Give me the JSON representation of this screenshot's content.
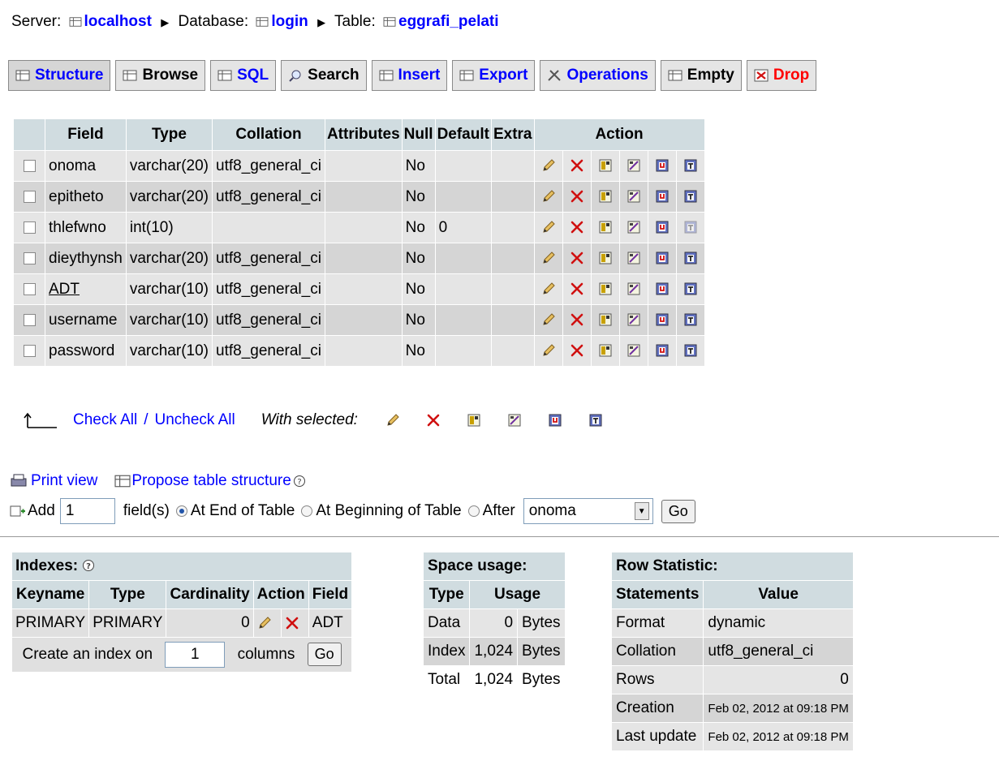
{
  "breadcrumb": {
    "server_label": "Server:",
    "server_value": "localhost",
    "database_label": "Database:",
    "database_value": "login",
    "table_label": "Table:",
    "table_value": "eggrafi_pelati",
    "separator": "▶"
  },
  "tabs": [
    {
      "label": "Structure",
      "icon": "structure-icon"
    },
    {
      "label": "Browse",
      "icon": "browse-icon"
    },
    {
      "label": "SQL",
      "icon": "sql-icon"
    },
    {
      "label": "Search",
      "icon": "search-icon"
    },
    {
      "label": "Insert",
      "icon": "insert-icon"
    },
    {
      "label": "Export",
      "icon": "export-icon"
    },
    {
      "label": "Operations",
      "icon": "operations-icon"
    },
    {
      "label": "Empty",
      "icon": "empty-icon"
    },
    {
      "label": "Drop",
      "icon": "drop-icon"
    }
  ],
  "structure": {
    "headers": [
      "Field",
      "Type",
      "Collation",
      "Attributes",
      "Null",
      "Default",
      "Extra",
      "Action"
    ],
    "rows": [
      {
        "field": "onoma",
        "type": "varchar(20)",
        "collation": "utf8_general_ci",
        "attributes": "",
        "null": "No",
        "default": "",
        "extra": ""
      },
      {
        "field": "epitheto",
        "type": "varchar(20)",
        "collation": "utf8_general_ci",
        "attributes": "",
        "null": "No",
        "default": "",
        "extra": ""
      },
      {
        "field": "thlefwno",
        "type": "int(10)",
        "collation": "",
        "attributes": "",
        "null": "No",
        "default": "0",
        "extra": ""
      },
      {
        "field": "dieythynsh",
        "type": "varchar(20)",
        "collation": "utf8_general_ci",
        "attributes": "",
        "null": "No",
        "default": "",
        "extra": ""
      },
      {
        "field": "ADT",
        "type": "varchar(10)",
        "collation": "utf8_general_ci",
        "attributes": "",
        "null": "No",
        "default": "",
        "extra": ""
      },
      {
        "field": "username",
        "type": "varchar(10)",
        "collation": "utf8_general_ci",
        "attributes": "",
        "null": "No",
        "default": "",
        "extra": ""
      },
      {
        "field": "password",
        "type": "varchar(10)",
        "collation": "utf8_general_ci",
        "attributes": "",
        "null": "No",
        "default": "",
        "extra": ""
      }
    ]
  },
  "bulk": {
    "check_all": "Check All",
    "slash": "/",
    "uncheck_all": "Uncheck All",
    "with_selected": "With selected:"
  },
  "tools": {
    "print_view": "Print view",
    "propose": "Propose table structure"
  },
  "add_field": {
    "add_label": "Add",
    "count_value": "1",
    "fields_label": "field(s)",
    "at_end": "At End of Table",
    "at_beginning": "At Beginning of Table",
    "after": "After",
    "after_selected": "onoma",
    "go": "Go"
  },
  "indexes": {
    "caption": "Indexes:",
    "headers": [
      "Keyname",
      "Type",
      "Cardinality",
      "Action",
      "Field"
    ],
    "rows": [
      {
        "keyname": "PRIMARY",
        "type": "PRIMARY",
        "cardinality": "0",
        "field": "ADT"
      }
    ],
    "create_label": "Create an index on",
    "create_value": "1",
    "columns_label": "columns",
    "go": "Go"
  },
  "space": {
    "caption": "Space usage:",
    "headers": [
      "Type",
      "Usage"
    ],
    "rows": [
      {
        "type": "Data",
        "usage": "0",
        "unit": "Bytes"
      },
      {
        "type": "Index",
        "usage": "1,024",
        "unit": "Bytes"
      },
      {
        "type": "Total",
        "usage": "1,024",
        "unit": "Bytes"
      }
    ]
  },
  "rowstat": {
    "caption": "Row Statistic:",
    "headers": [
      "Statements",
      "Value"
    ],
    "rows": [
      {
        "stmt": "Format",
        "value": "dynamic"
      },
      {
        "stmt": "Collation",
        "value": "utf8_general_ci"
      },
      {
        "stmt": "Rows",
        "value": "0"
      },
      {
        "stmt": "Creation",
        "value": "Feb 02, 2012 at 09:18 PM"
      },
      {
        "stmt": "Last update",
        "value": "Feb 02, 2012 at 09:18 PM"
      }
    ]
  }
}
